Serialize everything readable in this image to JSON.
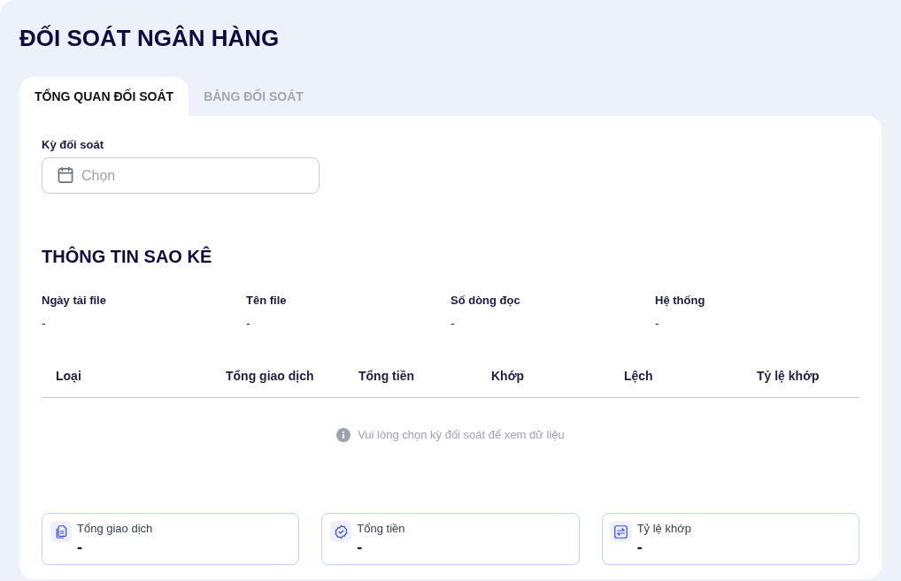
{
  "title": "ĐỐI SOÁT NGÂN HÀNG",
  "tabs": [
    {
      "label": "TỔNG QUAN ĐỐI SOÁT",
      "selected": true
    },
    {
      "label": "BẢNG ĐỐI SOÁT",
      "selected": false
    }
  ],
  "period_field": {
    "label": "Kỳ đối soát",
    "placeholder": "Chọn"
  },
  "statement_info": {
    "heading": "THÔNG TIN SAO KÊ",
    "fields": [
      {
        "label": "Ngày tải file",
        "value": "-"
      },
      {
        "label": "Tên file",
        "value": "-"
      },
      {
        "label": "Số dòng đọc",
        "value": "-"
      },
      {
        "label": "Hệ thống",
        "value": "-"
      }
    ]
  },
  "table": {
    "columns": [
      "Loại",
      "Tổng giao dịch",
      "Tổng tiền",
      "Khớp",
      "Lệch",
      "Tỷ lệ khớp"
    ],
    "empty_message": "Vui lòng chọn kỳ đối soát để xem dữ liệu"
  },
  "summary_cards": [
    {
      "kind": "transactions",
      "label": "Tổng giao dịch",
      "value": "-"
    },
    {
      "kind": "amount",
      "label": "Tổng tiền",
      "value": "-"
    },
    {
      "kind": "match_rate",
      "label": "Tỷ lệ khớp",
      "value": "-"
    }
  ]
}
